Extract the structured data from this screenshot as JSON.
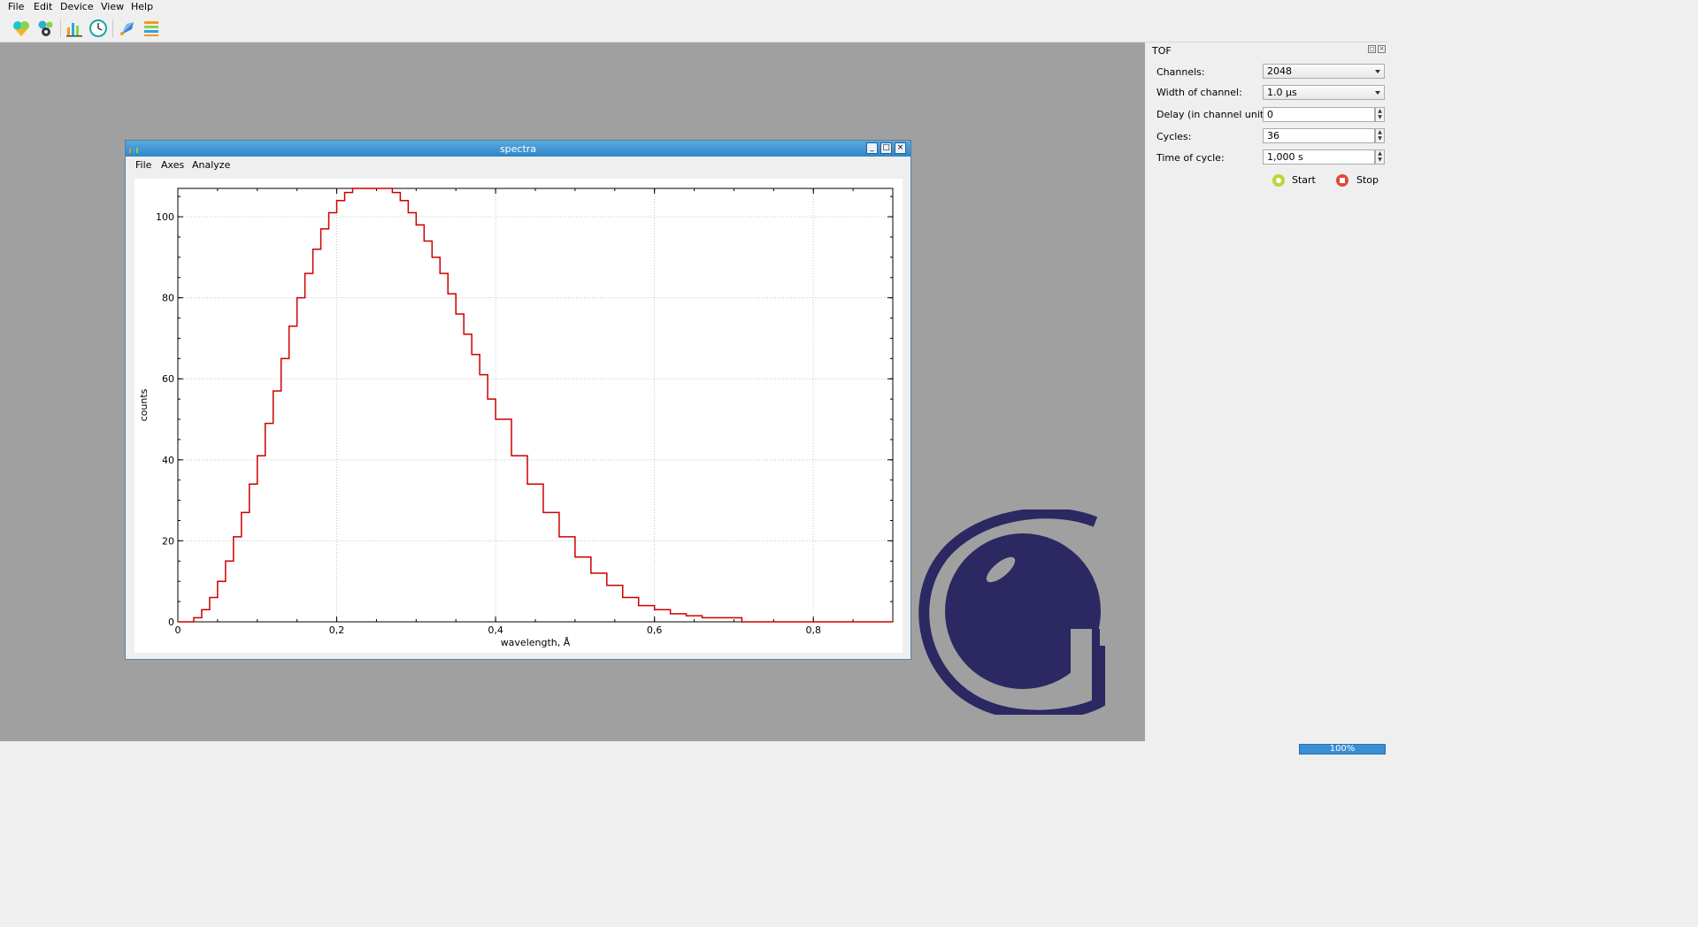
{
  "menubar": {
    "items": [
      "File",
      "Edit",
      "Device",
      "View",
      "Help"
    ]
  },
  "toolbar": {
    "icons": [
      "hands-icon",
      "gears-icon",
      "bar-chart-icon",
      "clock-icon",
      "rocket-icon",
      "books-icon"
    ]
  },
  "subwindow": {
    "title": "spectra",
    "menu": [
      "File",
      "Axes",
      "Analyze"
    ],
    "buttons": {
      "minimize": "_",
      "maximize": "□",
      "close": "×"
    }
  },
  "chart_data": {
    "type": "line",
    "title": "",
    "xlabel": "wavelength, Å",
    "ylabel": "counts",
    "xlim": [
      0,
      0.9
    ],
    "ylim": [
      0,
      107
    ],
    "xticks": [
      0,
      0.2,
      0.4,
      0.6,
      0.8
    ],
    "xtick_labels": [
      "0",
      "0,2",
      "0,4",
      "0,6",
      "0,8"
    ],
    "yticks": [
      0,
      20,
      40,
      60,
      80,
      100
    ],
    "ytick_labels": [
      "0",
      "20",
      "40",
      "60",
      "80",
      "100"
    ],
    "grid": true,
    "line_color": "#cc0000",
    "series": [
      {
        "x": [
          0.0,
          0.015,
          0.02,
          0.03,
          0.04,
          0.05,
          0.06,
          0.07,
          0.08,
          0.09,
          0.1,
          0.11,
          0.12,
          0.13,
          0.14,
          0.15,
          0.16,
          0.17,
          0.18,
          0.19,
          0.2,
          0.21,
          0.22,
          0.23,
          0.24,
          0.25,
          0.26,
          0.27,
          0.28,
          0.29,
          0.3,
          0.31,
          0.32,
          0.33,
          0.34,
          0.35,
          0.36,
          0.37,
          0.38,
          0.39,
          0.4,
          0.42,
          0.44,
          0.46,
          0.48,
          0.5,
          0.52,
          0.54,
          0.56,
          0.58,
          0.6,
          0.62,
          0.64,
          0.66,
          0.7,
          0.71,
          0.9
        ],
        "y": [
          0,
          0,
          1,
          3,
          6,
          10,
          15,
          21,
          27,
          34,
          41,
          49,
          57,
          65,
          73,
          80,
          86,
          92,
          97,
          101,
          104,
          106,
          107,
          107,
          107,
          107,
          107,
          106,
          104,
          101,
          98,
          94,
          90,
          86,
          81,
          76,
          71,
          66,
          61,
          55,
          50,
          41,
          34,
          27,
          21,
          16,
          12,
          9,
          6,
          4,
          3,
          2,
          1.5,
          1,
          1,
          0,
          0
        ]
      }
    ]
  },
  "dock": {
    "title": "TOF",
    "fields": [
      {
        "label": "Channels:",
        "value": "2048",
        "kind": "combo"
      },
      {
        "label": "Width of channel:",
        "value": "1.0 µs",
        "kind": "combo"
      },
      {
        "label": "Delay (in channel unit):",
        "value": "0",
        "kind": "spin"
      },
      {
        "label": "Cycles:",
        "value": "36",
        "kind": "spin"
      },
      {
        "label": "Time of cycle:",
        "value": "1,000 s",
        "kind": "spin"
      }
    ],
    "start_label": "Start",
    "stop_label": "Stop"
  },
  "status": {
    "progress_text": "100%",
    "progress": 1.0
  },
  "colors": {
    "logo": "#2b2862",
    "mdi_bg": "#a0a0a0",
    "title_bar": "#3b92d1",
    "line": "#cc0000"
  }
}
